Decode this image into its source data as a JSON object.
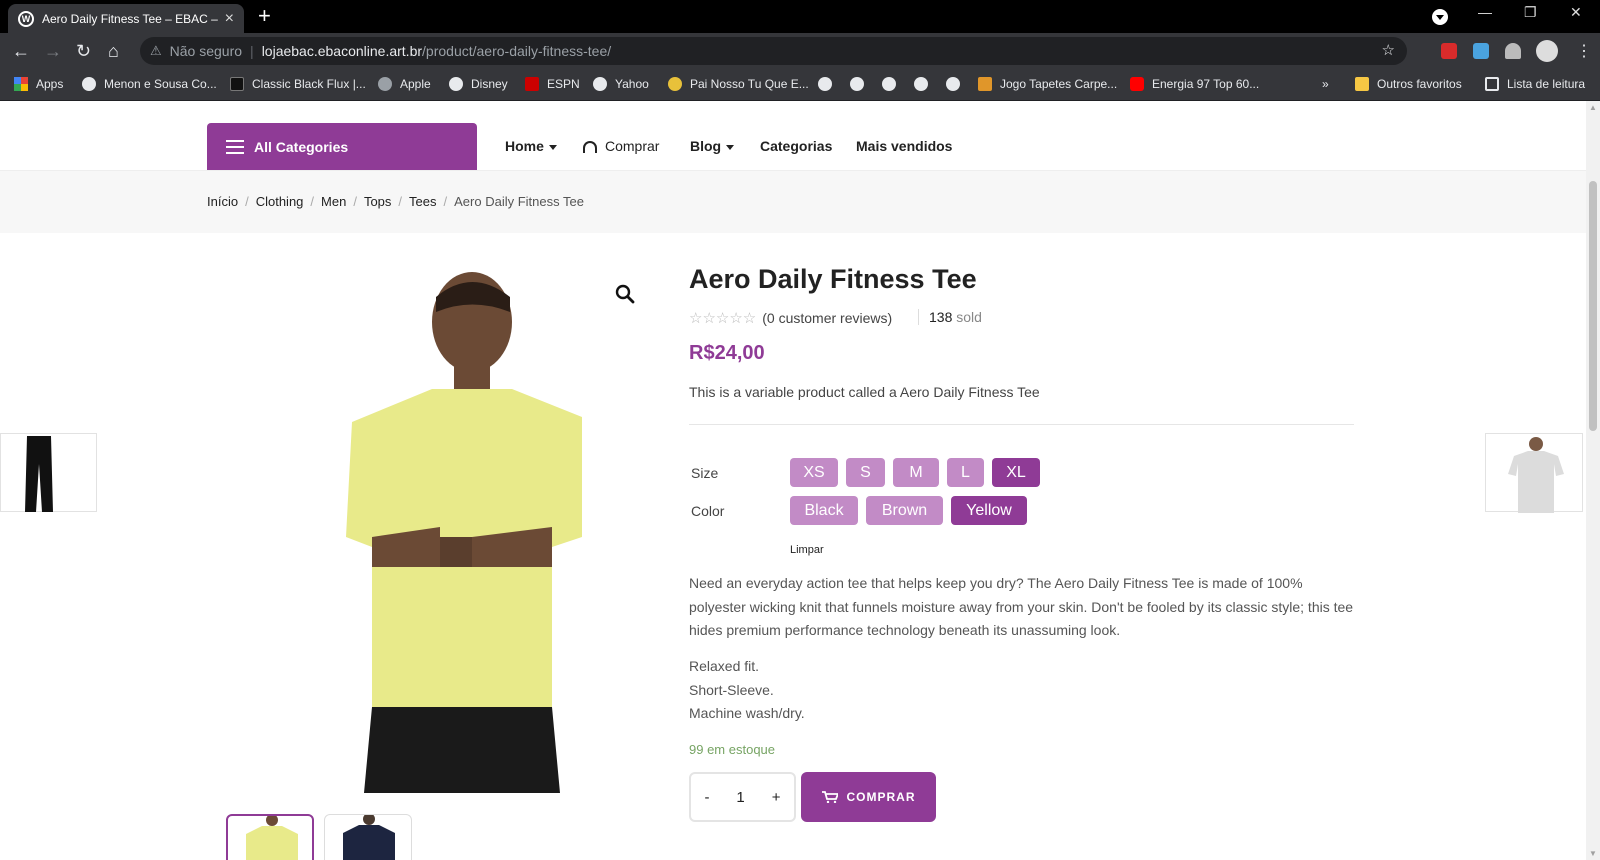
{
  "browser": {
    "tab_title": "Aero Daily Fitness Tee – EBAC – S",
    "tab_icon": "W",
    "new_tab": "+",
    "url_warning": "Não seguro",
    "url_host": "lojaebac.ebaconline.art.br",
    "url_path": "/product/aero-daily-fitness-tee/",
    "bookmarks": [
      {
        "label": "Apps",
        "icon": "apps-grid-icon"
      },
      {
        "label": "Menon e Sousa Co...",
        "icon": "globe-icon"
      },
      {
        "label": "Classic Black Flux |...",
        "icon": "site-icon"
      },
      {
        "label": "Apple",
        "icon": "apple-icon"
      },
      {
        "label": "Disney",
        "icon": "globe-icon"
      },
      {
        "label": "ESPN",
        "icon": "espn-icon"
      },
      {
        "label": "Yahoo",
        "icon": "globe-icon"
      },
      {
        "label": "Pai Nosso Tu Que E...",
        "icon": "site-icon"
      },
      {
        "label": "Jogo Tapetes Carpe...",
        "icon": "site-icon"
      },
      {
        "label": "Energia 97 Top 60...",
        "icon": "youtube-icon"
      }
    ],
    "bookmarks_more": "»",
    "other_favorites": "Outros favoritos",
    "reading_list": "Lista de leitura"
  },
  "nav": {
    "all_categories": "All Categories",
    "menu": {
      "home": "Home",
      "comprar": "Comprar",
      "blog": "Blog",
      "categorias": "Categorias",
      "mais_vendidos": "Mais vendidos"
    }
  },
  "breadcrumb": {
    "items": [
      "Início",
      "Clothing",
      "Men",
      "Tops",
      "Tees"
    ],
    "current": "Aero Daily Fitness Tee",
    "separator": "/"
  },
  "product": {
    "title": "Aero Daily Fitness Tee",
    "stars": "☆☆☆☆☆",
    "rating_value": 0,
    "reviews": "(0 customer reviews)",
    "sold_count": "138",
    "sold_label": "sold",
    "price": "R$24,00",
    "short_description": "This is a variable product called a Aero Daily Fitness Tee",
    "size_label": "Size",
    "sizes": [
      "XS",
      "S",
      "M",
      "L",
      "XL"
    ],
    "selected_size": "XL",
    "color_label": "Color",
    "colors": [
      "Black",
      "Brown",
      "Yellow"
    ],
    "selected_color": "Yellow",
    "clear_label": "Limpar",
    "long_description": "Need an everyday action tee that helps keep you dry? The Aero Daily Fitness Tee is made of 100% polyester wicking knit that funnels moisture away from your skin. Don't be fooled by its classic style; this tee hides premium performance technology beneath its unassuming look.",
    "features": [
      "Relaxed fit.",
      "Short-Sleeve.",
      "Machine wash/dry."
    ],
    "stock": "99 em estoque",
    "quantity": "1",
    "qty_minus": "-",
    "qty_plus": "+",
    "buy_label": "COMPRAR"
  },
  "colors": {
    "accent": "#8f3b96",
    "chip_unselected": "#c28bc6",
    "stock_green": "#77a464",
    "tee_yellow": "#e8ea8a"
  }
}
